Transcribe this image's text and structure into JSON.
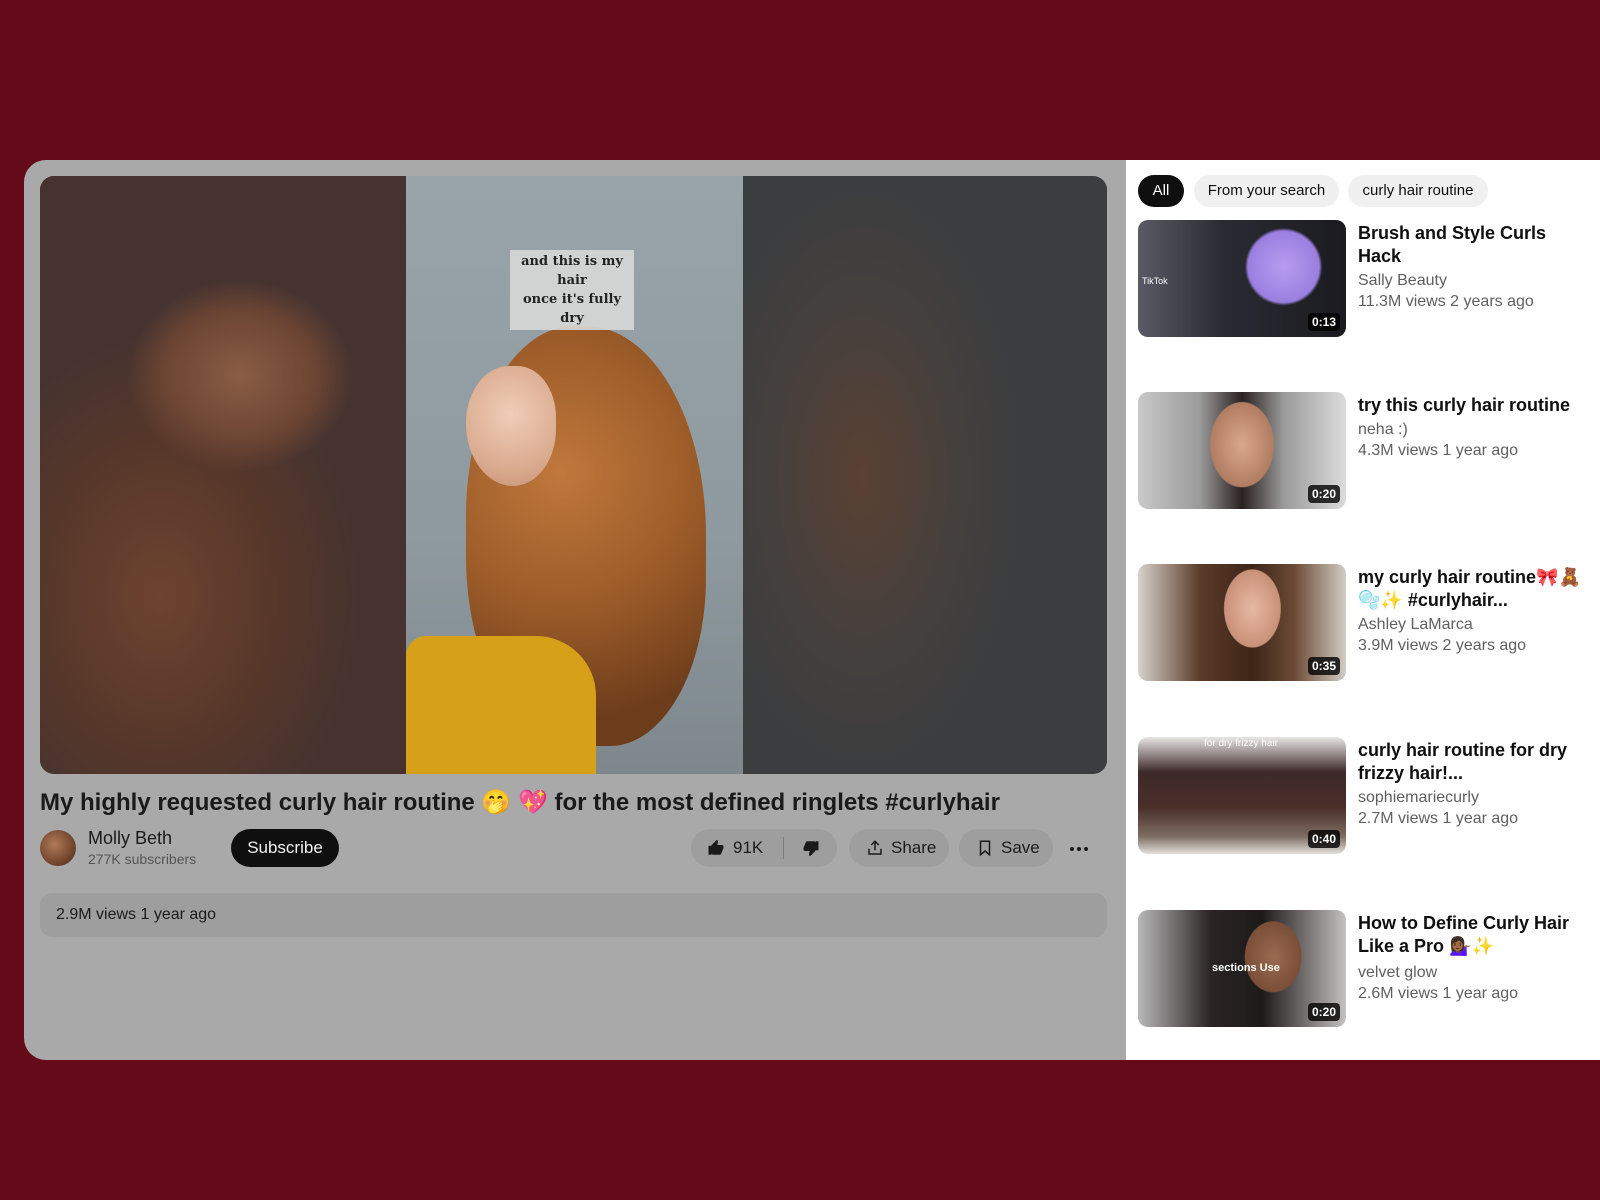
{
  "player": {
    "caption_line1": "and this is my hair",
    "caption_line2": "once it's fully dry"
  },
  "video": {
    "title": "My highly requested curly hair routine 🤭 💖  for the most defined ringlets #curlyhair",
    "channel_name": "Molly Beth",
    "subscribers": "277K subscribers",
    "subscribe_label": "Subscribe",
    "like_count": "91K",
    "share_label": "Share",
    "save_label": "Save",
    "views_and_date": "2.9M views 1 year ago"
  },
  "chips": [
    {
      "label": "All",
      "active": true
    },
    {
      "label": "From your search",
      "active": false
    },
    {
      "label": "curly hair routine",
      "active": false
    }
  ],
  "recommendations": [
    {
      "title": "Brush and Style Curls Hack",
      "channel": "Sally Beauty",
      "meta": "11.3M views 2 years ago",
      "duration": "0:13",
      "thumb_text": "TikTok"
    },
    {
      "title": "try this curly hair routine",
      "channel": "neha :)",
      "meta": "4.3M views 1 year ago",
      "duration": "0:20",
      "thumb_text": ""
    },
    {
      "title": "my curly hair routine🎀🧸🫧✨ #curlyhair...",
      "channel": "Ashley LaMarca",
      "meta": "3.9M views 2 years ago",
      "duration": "0:35",
      "thumb_text": ""
    },
    {
      "title": "curly hair routine for dry frizzy hair!...",
      "channel": "sophiemariecurly",
      "meta": "2.7M views 1 year ago",
      "duration": "0:40",
      "thumb_text": "for dry frizzy hair"
    },
    {
      "title": "How to Define Curly Hair Like a Pro 💁🏾‍♀️✨",
      "channel": "velvet glow",
      "meta": "2.6M views 1 year ago",
      "duration": "0:20",
      "thumb_text": "sections Use"
    }
  ]
}
